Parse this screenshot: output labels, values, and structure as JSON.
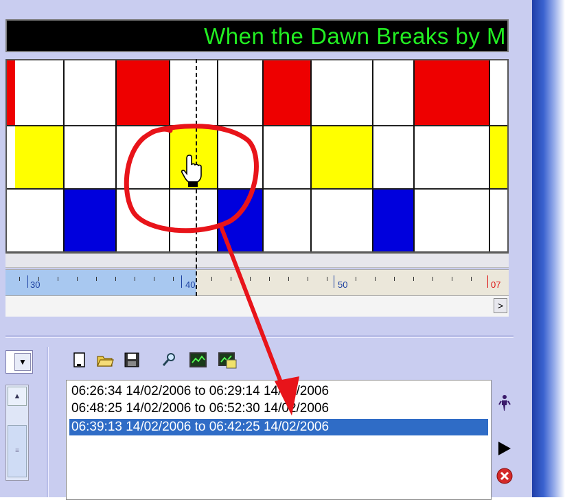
{
  "banner": {
    "text": "When the Dawn Breaks by M"
  },
  "colors": {
    "red": "#ee0000",
    "yellow": "#ffff00",
    "blue": "#0000dd",
    "selection": "#2f6cc6",
    "banner_text": "#22ee22"
  },
  "ruler": {
    "labels": [
      "30",
      "40",
      "50",
      "07"
    ]
  },
  "scroll": {
    "right_arrow": ">"
  },
  "dropdown": {
    "arrow": "▼"
  },
  "left_scroll": {
    "up_arrow": "▲",
    "thumb_grip": "≡"
  },
  "toolbar": {
    "icons": [
      "new-document-icon",
      "open-folder-icon",
      "save-icon",
      "search-icon",
      "graph-icon",
      "chart-scan-icon"
    ]
  },
  "selections": {
    "rows": [
      "06:26:34 14/02/2006 to 06:29:14 14/02/2006",
      "06:48:25 14/02/2006 to 06:52:30 14/02/2006",
      "06:39:13 14/02/2006 to 06:42:25 14/02/2006"
    ],
    "selected_index": 2
  },
  "side_buttons": [
    "person-icon",
    "play-icon",
    "close-icon"
  ]
}
